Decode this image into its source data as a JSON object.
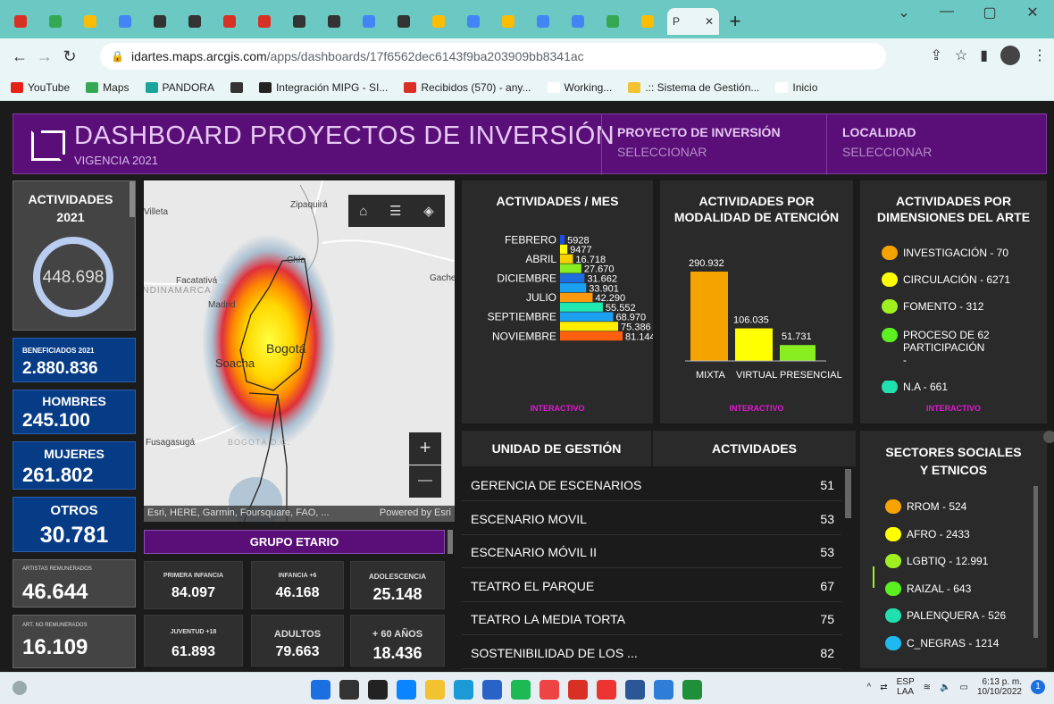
{
  "browser": {
    "active_tab_label": "P",
    "url_host": "idartes.maps.arcgis.com",
    "url_path": "/apps/dashboards/17f6562dec6143f9ba203909bb8341ac",
    "bookmarks": [
      "YouTube",
      "Maps",
      "PANDORA",
      "",
      "Integración MIPG - SI...",
      "Recibidos (570) - any...",
      "Working...",
      ".:: Sistema de Gestión...",
      "Inicio"
    ]
  },
  "header": {
    "title": "DASHBOARD PROYECTOS DE INVERSIÓN",
    "subtitle": "VIGENCIA 2021",
    "proyecto_label": "PROYECTO DE INVERSIÓN",
    "proyecto_value": "SELECCIONAR",
    "localidad_label": "LOCALIDAD",
    "localidad_value": "SELECCIONAR"
  },
  "left": {
    "actividades_label": "ACTIVIDADES",
    "actividades_year": "2021",
    "actividades_value": "448.698",
    "beneficiados_label": "BENEFICIADOS 2021",
    "beneficiados_value": "2.880.836",
    "hombres_label": "HOMBRES",
    "hombres_value": "245.100",
    "mujeres_label": "MUJERES",
    "mujeres_value": "261.802",
    "otros_label": "OTROS",
    "otros_value": "30.781",
    "artistas_rem_label": "ARTISTAS REMUNERADOS",
    "artistas_rem_value": "46.644",
    "artistas_norem_label": "ART. NO REMUNERADOS",
    "artistas_norem_value": "16.109"
  },
  "map": {
    "places": [
      "Zipaquirá",
      "Villeta",
      "Chía",
      "Facatativá",
      "Gachet",
      "Madrid",
      "CUNDINAMARCA",
      "Bogotá",
      "Soacha",
      "Fusagasugá",
      "BOGOTÁ D.C."
    ],
    "attribution": "Esri, HERE, Garmin, Foursquare, FAO, ...",
    "powered": "Powered by Esri",
    "zoom_in": "+",
    "zoom_out": "—"
  },
  "grupo_etario": {
    "title": "GRUPO ETARIO",
    "cells": [
      {
        "label": "PRIMERA INFANCIA",
        "value": "84.097"
      },
      {
        "label": "INFANCIA +6",
        "value": "46.168"
      },
      {
        "label": "ADOLESCENCIA",
        "value": "25.148"
      },
      {
        "label": "JUVENTUD +18",
        "value": "61.893"
      },
      {
        "label": "ADULTOS",
        "value": "79.663"
      },
      {
        "label": "+ 60 AÑOS",
        "value": "18.436"
      }
    ]
  },
  "actividades_mes": {
    "title": "ACTIVIDADES / MES",
    "month_labels": [
      "FEBRERO",
      "ABRIL",
      "DICIEMBRE",
      "JULIO",
      "SEPTIEMBRE",
      "NOVIEMBRE"
    ],
    "value_labels": [
      "5928",
      "9477",
      "16.718",
      "27.670",
      "31.662",
      "33.901",
      "42.290",
      "55.552",
      "68.970",
      "75.386",
      "81.144"
    ],
    "interactivo": "INTERACTIVO"
  },
  "modalidad": {
    "title_line1": "ACTIVIDADES POR",
    "title_line2": "MODALIDAD DE ATENCIÓN",
    "value_labels": [
      "290.932",
      "106.035",
      "51.731"
    ],
    "category_labels": [
      "MIXTA",
      "VIRTUAL",
      "PRESENCIAL"
    ],
    "interactivo": "INTERACTIVO"
  },
  "dimensiones": {
    "title_line1": "ACTIVIDADES POR",
    "title_line2": "DIMENSIONES DEL ARTE",
    "items": [
      {
        "label": "INVESTIGACIÓN - 70",
        "color": "#f5a300"
      },
      {
        "label": "CIRCULACIÓN - 6271",
        "color": "#ffff00"
      },
      {
        "label": "FOMENTO - 312",
        "color": "#a0f020"
      },
      {
        "label": "PROCESO DE    62",
        "label2": "PARTICIPACIÓN",
        "label3": "-",
        "color": "#5cf020"
      },
      {
        "label": "N.A - 661",
        "color": "#20e0b0"
      }
    ],
    "interactivo": "INTERACTIVO"
  },
  "unidad": {
    "col1": "UNIDAD DE GESTIÓN",
    "col2": "ACTIVIDADES",
    "rows": [
      {
        "name": "GERENCIA DE ESCENARIOS",
        "value": "51"
      },
      {
        "name": "ESCENARIO MOVIL",
        "value": "53"
      },
      {
        "name": "ESCENARIO MÓVIL II",
        "value": "53"
      },
      {
        "name": "TEATRO EL PARQUE",
        "value": "67"
      },
      {
        "name": "TEATRO LA MEDIA TORTA",
        "value": "75"
      },
      {
        "name": "SOSTENIBILIDAD DE LOS ...",
        "value": "82"
      }
    ]
  },
  "sectores": {
    "title_line1": "SECTORES SOCIALES",
    "title_line2": "Y ETNICOS",
    "items": [
      {
        "label": "RROM - 524",
        "color": "#f5a300"
      },
      {
        "label": "AFRO - 2433",
        "color": "#ffff00"
      },
      {
        "label": "LGBTIQ - 12.991",
        "color": "#a0f020"
      },
      {
        "label": "RAIZAL - 643",
        "color": "#5cf020"
      },
      {
        "label": "PALENQUERA - 526",
        "color": "#20e0b0"
      },
      {
        "label": "C_NEGRAS - 1214",
        "color": "#20b8f0"
      }
    ]
  },
  "taskbar": {
    "lang1": "ESP",
    "lang2": "LAA",
    "time": "6:13 p. m.",
    "date": "10/10/2022"
  },
  "chart_data": [
    {
      "type": "bar",
      "title": "ACTIVIDADES / MES",
      "orientation": "horizontal",
      "values": [
        5928,
        9477,
        16718,
        27670,
        31662,
        33901,
        42290,
        55552,
        68970,
        75386,
        81144
      ],
      "colors": [
        "#1e4fe0",
        "#ffff00",
        "#f5d000",
        "#88ee22",
        "#1e6ee0",
        "#19a0f0",
        "#ff9a10",
        "#20e8b0",
        "#1ea0f0",
        "#ffee00",
        "#ff6010"
      ]
    },
    {
      "type": "bar",
      "title": "ACTIVIDADES POR MODALIDAD DE ATENCIÓN",
      "categories": [
        "MIXTA",
        "VIRTUAL",
        "PRESENCIAL"
      ],
      "values": [
        290932,
        106035,
        51731
      ],
      "colors": [
        "#f5a300",
        "#ffff00",
        "#88ee22"
      ]
    }
  ]
}
